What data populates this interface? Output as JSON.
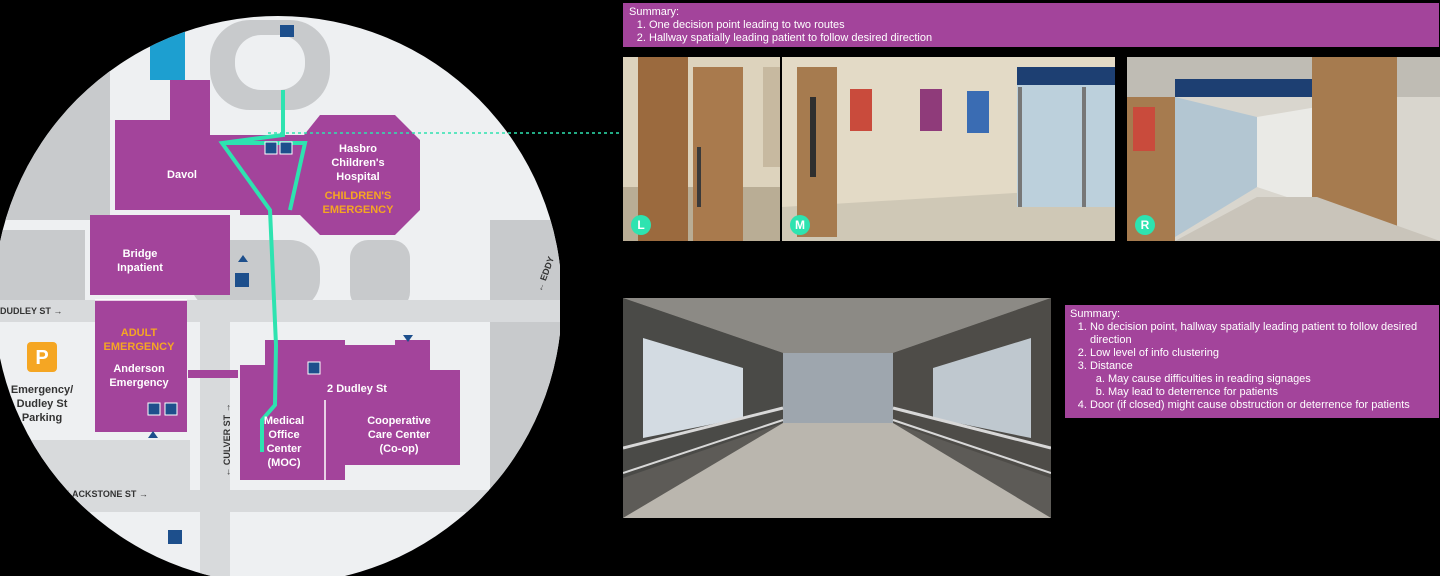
{
  "map": {
    "buildings": {
      "davol": "Davol",
      "hasbro_1": "Hasbro",
      "hasbro_2": "Children's",
      "hasbro_3": "Hospital",
      "childrens_emergency_1": "CHILDREN'S",
      "childrens_emergency_2": "EMERGENCY",
      "bridge_1": "Bridge",
      "bridge_2": "Inpatient",
      "adult_emergency_1": "ADULT",
      "adult_emergency_2": "EMERGENCY",
      "anderson_1": "Anderson",
      "anderson_2": "Emergency",
      "dudley2": "2 Dudley St",
      "moc_1": "Medical",
      "moc_2": "Office",
      "moc_3": "Center",
      "moc_4": "(MOC)",
      "coop_1": "Cooperative",
      "coop_2": "Care Center",
      "coop_3": "(Co-op)",
      "parking_1": "Emergency/",
      "parking_2": "Dudley St",
      "parking_3": "Parking"
    },
    "streets": {
      "dudley": "DUDLEY ST →",
      "culver": "← CULVER ST →",
      "blackstone": "BLACKSTONE ST →",
      "eddy": "← EDDY"
    },
    "icons": {
      "parking": "P",
      "info": "i"
    },
    "colors": {
      "building": "#a3449b",
      "route": "#2ee3b0",
      "label_orange": "#f5a623",
      "road": "#c8cacc",
      "land": "#eef0f2"
    }
  },
  "summary_top": {
    "title": "Summary:",
    "items": [
      "One decision point leading to two routes",
      "Hallway spatially leading patient to follow desired direction"
    ]
  },
  "photos": {
    "left_badge": "L",
    "middle_badge": "M",
    "right_badge": "R"
  },
  "summary_bottom": {
    "title": "Summary:",
    "item1": "No decision point, hallway spatially leading patient to follow desired direction",
    "item2": "Low level of info clustering",
    "item3": "Distance",
    "item3a": "May cause difficulties in reading signages",
    "item3b": "May lead to deterrence for patients",
    "item4": "Door (if closed) might cause obstruction or deterrence for patients"
  }
}
